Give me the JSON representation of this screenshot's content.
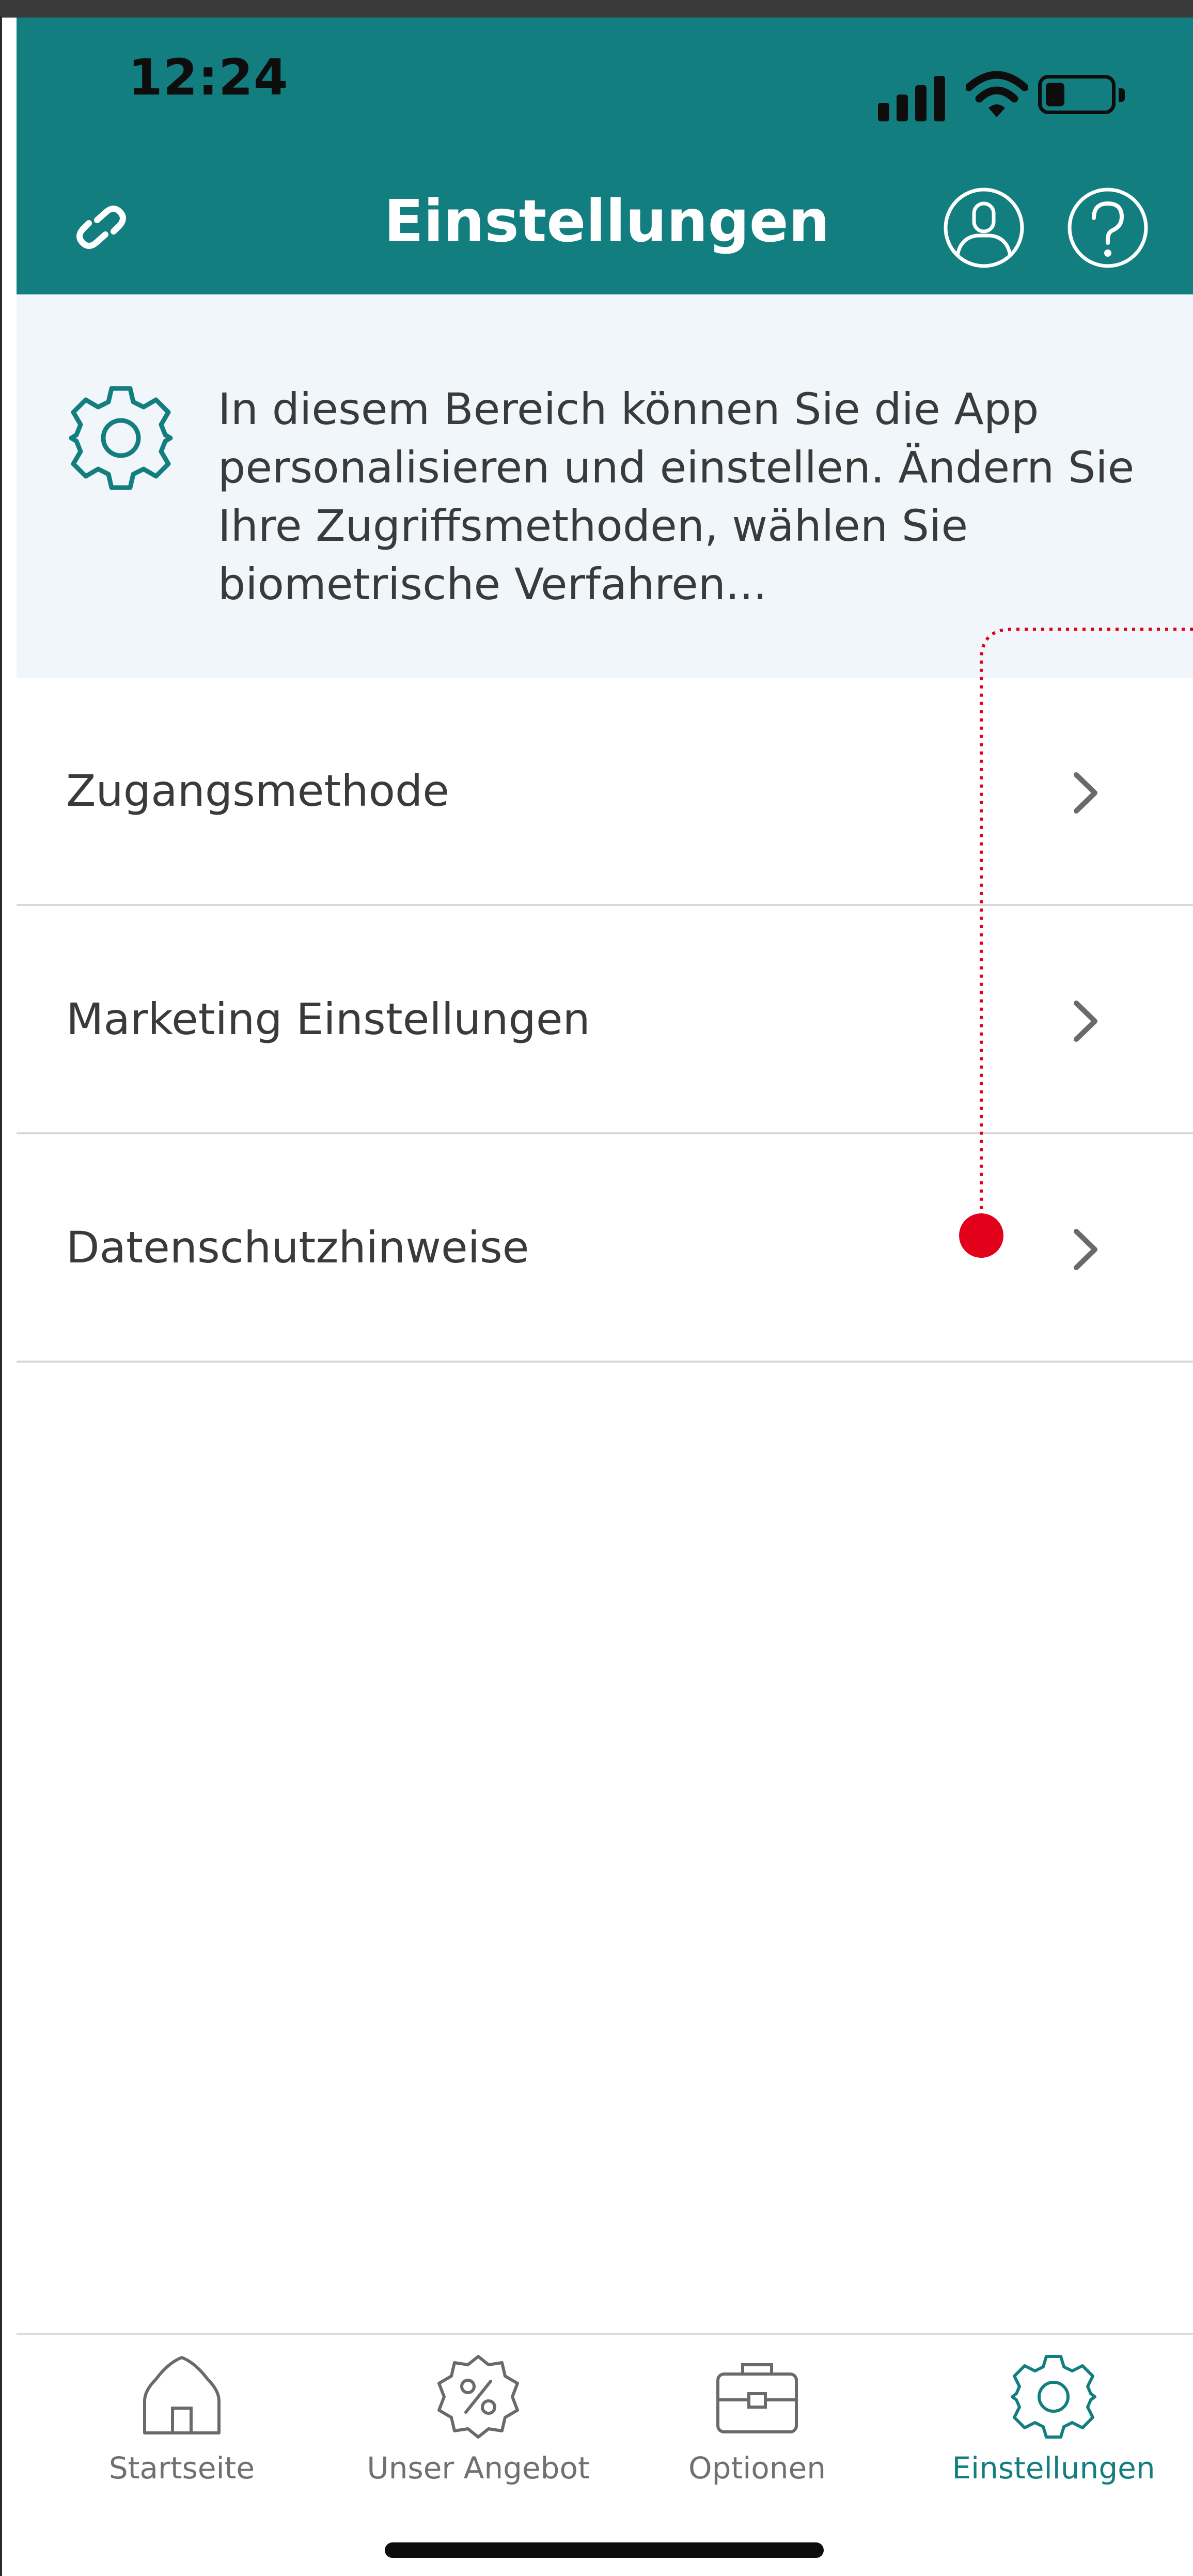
{
  "status_bar": {
    "time": "12:24",
    "battery_level": 0.3
  },
  "header": {
    "title": "Einstellungen",
    "left_icon": "link-icon",
    "right_icons": [
      "profile-icon",
      "help-icon"
    ]
  },
  "banner": {
    "icon": "gear-icon",
    "text": "In diesem Bereich können Sie die App personalisieren und einstellen. Ändern Sie Ihre Zugriffsmethoden, wählen Sie biometrische Verfahren..."
  },
  "menu": {
    "items": [
      {
        "label": "Zugangsmethode"
      },
      {
        "label": "Marketing Einstellungen"
      },
      {
        "label": "Datenschutzhinweise"
      }
    ]
  },
  "tabbar": {
    "tabs": [
      {
        "label": "Startseite",
        "icon": "home-icon",
        "active": false
      },
      {
        "label": "Unser Angebot",
        "icon": "percent-badge-icon",
        "active": false
      },
      {
        "label": "Optionen",
        "icon": "briefcase-icon",
        "active": false
      },
      {
        "label": "Einstellungen",
        "icon": "gear-icon",
        "active": true
      }
    ]
  },
  "colors": {
    "brand": "#137e80",
    "banner_bg": "#f0f6f9",
    "annotation": "#e3001b",
    "text": "#3a3a3a",
    "tab_inactive": "#707070"
  }
}
